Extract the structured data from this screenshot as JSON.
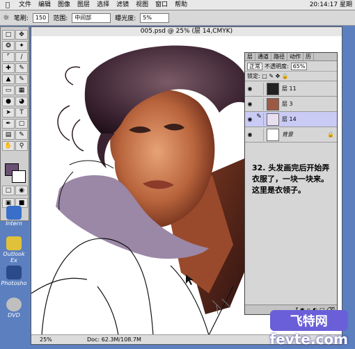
{
  "menubar": {
    "items": [
      "文件",
      "编辑",
      "图像",
      "图层",
      "选择",
      "滤镜",
      "视图",
      "窗口",
      "帮助"
    ],
    "clock": "20:14:17 星期"
  },
  "options": {
    "brush_label": "笔刷:",
    "brush_size": "150",
    "range_label": "范围:",
    "range_value": "中间部",
    "exposure_label": "曝光度:",
    "exposure_value": "5%"
  },
  "document": {
    "title": "005.psd @ 25% (层 14,CMYK)",
    "zoom": "25%",
    "doc_size": "Doc: 62.3M/108.7M"
  },
  "layers_panel": {
    "tabs": [
      "层",
      "通道",
      "路径",
      "动作",
      "历"
    ],
    "blend_mode": "正常",
    "opacity_label": "不透明度:",
    "opacity": "65%",
    "lock_label": "锁定:",
    "layers": [
      {
        "name": "层 11",
        "active": false
      },
      {
        "name": "层 3",
        "active": false
      },
      {
        "name": "层 14",
        "active": true
      },
      {
        "name": "背景",
        "active": false
      }
    ],
    "note": "32. 头发画完后开始弄衣服了，一块一块来。这里是衣领子。"
  },
  "desktop": {
    "icons": [
      "Intern",
      "Outlook Ex",
      "Photosho",
      "DVD"
    ]
  },
  "watermark": {
    "brand": "飞特网",
    "url": "fevte.com"
  },
  "colors": {
    "foreground": "#6a5074",
    "background": "#ffffff",
    "collar": "#9b87a6"
  }
}
